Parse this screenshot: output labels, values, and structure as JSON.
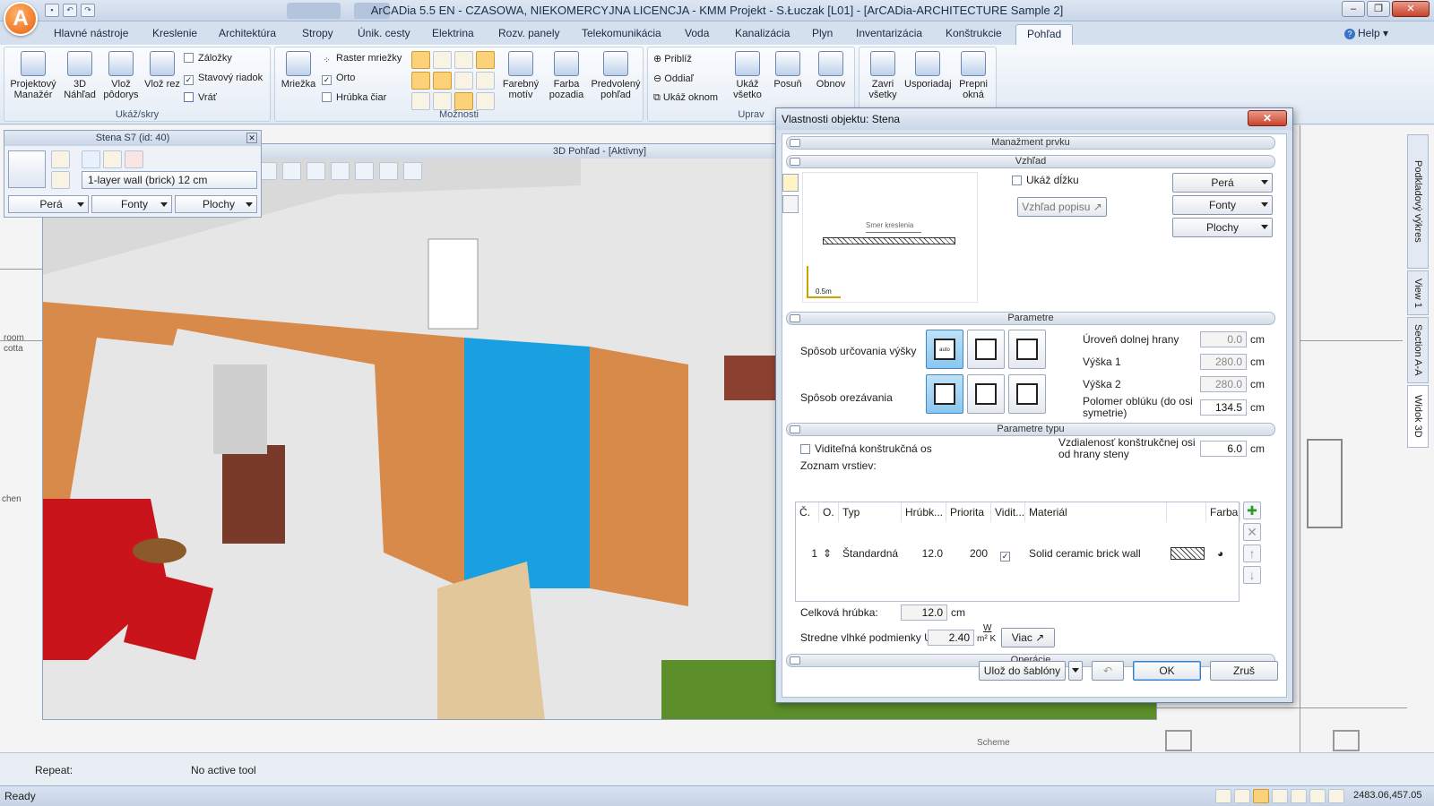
{
  "window": {
    "title": "ArCADia 5.5 EN - CZASOWA, NIEKOMERCYJNA LICENCJA - KMM Projekt - S.Łuczak [L01] - [ArCADia-ARCHITECTURE Sample 2]",
    "logo": "A",
    "help": "Help"
  },
  "tabs": [
    "Hlavné nástroje",
    "Kreslenie",
    "Architektúra",
    "Stropy",
    "Únik. cesty",
    "Elektrina",
    "Rozv. panely",
    "Telekomunikácia",
    "Voda",
    "Kanalizácia",
    "Plyn",
    "Inventarizácia",
    "Konštrukcie",
    "Pohľad"
  ],
  "ribbon": {
    "ukaz_skry": {
      "label": "Ukáž/skry",
      "projektovy": "Projektový Manažér",
      "nahlad3d": "3D Náhľad",
      "vloz_podorys": "Vlož pôdorys",
      "vloz_rez": "Vlož rez",
      "zalozky": "Záložky",
      "stavovy": "Stavový riadok",
      "vrat": "Vráť"
    },
    "moznosti": {
      "label": "Možnosti",
      "mriezka": "Mriežka",
      "raster": "Raster mriežky",
      "orto": "Orto",
      "hrubka": "Hrúbka čiar",
      "farebny": "Farebný motív",
      "farba": "Farba pozadia",
      "predvoleny": "Predvolený pohľad"
    },
    "uprav": {
      "label": "Uprav",
      "pribliz": "Priblíž",
      "oddial": "Oddiaľ",
      "ukaz_oknom": "Ukáž oknom",
      "ukaz_vsetko": "Ukáž všetko",
      "posun": "Posuň",
      "obnov": "Obnov"
    },
    "okna": {
      "zavri": "Zavri všetky",
      "usporiadaj": "Usporiadaj",
      "prepni": "Prepni okná"
    }
  },
  "minipanel": {
    "title": "Stena S7 (id: 40)",
    "wall_type": "1-layer wall (brick) 12 cm",
    "pera": "Perá",
    "fonty": "Fonty",
    "plochy": "Plochy"
  },
  "view3d": {
    "title": "3D Pohľad - [Aktívny]"
  },
  "dialog": {
    "title": "Vlastnosti objektu: Stena",
    "sections": {
      "manazment": "Manažment prvku",
      "vzhlad": "Vzhľad",
      "parametre": "Parametre",
      "parametre_typu": "Parametre typu",
      "operacie": "Operácie"
    },
    "vzhlad": {
      "smer": "Smer kreslenia",
      "scale": "0.5m",
      "ukaz_dlzku": "Ukáž dĺžku",
      "vzhlad_popisu": "Vzhľad popisu",
      "pera": "Perá",
      "fonty": "Fonty",
      "plochy": "Plochy"
    },
    "parametre": {
      "sposob_vysky": "Spôsob určovania výšky",
      "auto": "auto",
      "sposob_orezavania": "Spôsob orezávania",
      "uroven": "Úroveň dolnej hrany",
      "uroven_val": "0.0",
      "vyska1": "Výška 1",
      "vyska1_val": "280.0",
      "vyska2": "Výška 2",
      "vyska2_val": "280.0",
      "polomer": "Polomer oblúku (do osi symetrie)",
      "polomer_val": "134.5",
      "unit": "cm"
    },
    "typu": {
      "viditelna": "Viditeľná konštrukčná os",
      "vzdialenost": "Vzdialenosť konštrukčnej osi od hrany steny",
      "vzdialenost_val": "6.0",
      "zoznam": "Zoznam vrstiev:"
    },
    "table": {
      "headers": [
        "Č.",
        "O.",
        "Typ",
        "Hrúbk...",
        "Priorita",
        "Vidit...",
        "Materiál",
        "",
        "Farba"
      ],
      "rows": [
        {
          "c": "1",
          "typ": "Štandardná",
          "hrubka": "12.0",
          "priorita": "200",
          "material": "Solid ceramic brick wall"
        }
      ]
    },
    "celkova": "Celková hrúbka:",
    "celkova_val": "12.0",
    "celkova_unit": "cm",
    "stredne": "Stredne vlhké podmienky U =",
    "stredne_val": "2.40",
    "u_unit_top": "W",
    "u_unit_bottom": "m² K",
    "viac": "Viac",
    "buttons": {
      "uloz": "Ulož do šablóny",
      "ok": "OK",
      "zrus": "Zruš"
    }
  },
  "side_tabs": [
    "Podkladový výkres",
    "View 1",
    "Section A-A",
    "Widok 3D"
  ],
  "drawing_labels": {
    "room": "room",
    "cotta": "cotta",
    "chen": "chen",
    "scheme": "Scheme"
  },
  "command": {
    "repeat": "Repeat:",
    "tool": "No active tool"
  },
  "status": {
    "ready": "Ready",
    "coords": "2483.06,457.05"
  },
  "colors": {
    "accent": "#fbd27a",
    "wall": "#d88a4b",
    "tile": "#1aa0e0",
    "sofa": "#c8141a"
  }
}
